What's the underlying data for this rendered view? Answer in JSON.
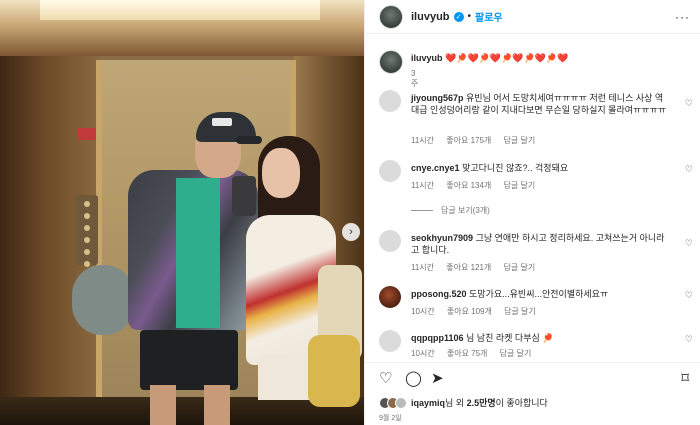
{
  "header": {
    "username": "iluvyub",
    "verified_icon": "verified-badge-icon",
    "separator": "•",
    "follow_label": "팔로우",
    "more_icon": "more-horizontal-icon",
    "more_label": "···"
  },
  "caption": {
    "username": "iluvyub",
    "text": "❤️🏓❤️🏓❤️🏓❤️🏓❤️🏓❤️",
    "time": "3주"
  },
  "comments": [
    {
      "username": "jiyoung567p",
      "text": "유빈님 어서 도망치세여ㅠㅠㅠㅠ 저런 테니스 사상 역대급 인성덩어리랑 같이 지내다보면 무슨일 당하실지 몰라여ㅠㅠㅠㅠ",
      "time": "11시간",
      "likes": "좋아요 175개",
      "reply": "답글 달기"
    },
    {
      "username": "cnye.cnye1",
      "text": "맞고다니진 않죠?.. 걱정돼요",
      "time": "11시간",
      "likes": "좋아요 134개",
      "reply": "답글 달기"
    },
    {
      "username": "seokhyun7909",
      "text": "그냥 연애만 하시고 정리하세요. 고쳐쓰는거 아니라고 합니다.",
      "time": "11시간",
      "likes": "좋아요 121개",
      "reply": "답글 달기"
    },
    {
      "username": "pposong.520",
      "text": "도망가요...유빈씨...안전이별하세요ㅠ",
      "time": "10시간",
      "likes": "좋아요 109개",
      "reply": "답글 달기"
    },
    {
      "username": "qqpqpp1106",
      "text": "님 남친 라켓 다부심 🏓",
      "time": "10시간",
      "likes": "좋아요 75개",
      "reply": "답글 달기"
    }
  ],
  "view_replies": "답글 보기(3개)",
  "actions": {
    "like_icon": "heart-outline-icon",
    "comment_icon": "comment-icon",
    "share_icon": "send-icon",
    "save_icon": "bookmark-icon"
  },
  "likes_line": {
    "user": "iqaymiq",
    "middle": "님 외 ",
    "count": "2.5만명",
    "suffix": "이 좋아합니다"
  },
  "date": "9월 2일",
  "photo": {
    "next_icon": "chevron-right-icon"
  }
}
